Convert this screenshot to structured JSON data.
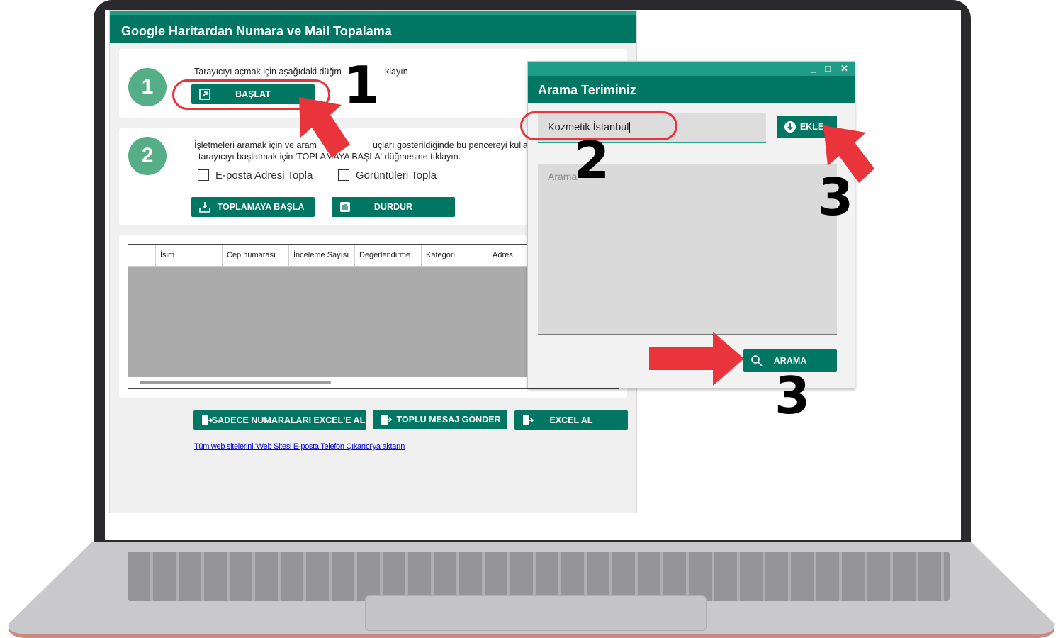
{
  "main_window": {
    "title": "Google Haritardan Numara ve Mail Topalama",
    "step1": {
      "number": "1",
      "instruction": "Tarayıcıyı açmak için aşağıdaki düğm",
      "instruction_end": "klayın",
      "start_button": "BAŞLAT"
    },
    "step2": {
      "number": "2",
      "instruction_line1": "İşletmeleri aramak için ve aram",
      "instruction_line1_end": "uçları gösterildiğinde bu pencereyi kullanın",
      "instruction_line2": "tarayıcıyı başlatmak için 'TOPLAMAYA BAŞLA' düğmesine tıklayın.",
      "checkbox_email": "E-posta Adresi Topla",
      "checkbox_images": "Görüntüleri Topla",
      "start_collect_button": "TOPLAMAYA BAŞLA",
      "stop_button": "DURDUR"
    },
    "table": {
      "columns": [
        "İsim",
        "Cep numarası",
        "İnceleme Sayısı",
        "Değerlendirme",
        "Kategori",
        "Adres"
      ]
    },
    "bottom_buttons": {
      "excel_numbers": "SADECE NUMARALARI EXCEL'E AL",
      "bulk_message": "TOPLU MESAJ GÖNDER",
      "excel": "EXCEL AL"
    },
    "link_text": "Tüm web sitelerini 'Web Sitesi E-posta Telefon Çıkarıcı'ya aktarın"
  },
  "dialog": {
    "title": "Arama Teriminiz",
    "controls": [
      "_",
      "□",
      "✕"
    ],
    "search_input_value": "Kozmetik İstanbul",
    "add_button": "EKLE",
    "textarea_placeholder": "Arama",
    "search_button": "ARAMA"
  },
  "annotations": {
    "label_1": "1",
    "label_2": "2",
    "label_3a": "3",
    "label_3b": "3"
  },
  "colors": {
    "brand_green": "#007663",
    "title_strip": "#1f9c85",
    "step_circle": "#55ae86",
    "annotation_red": "#e8343a"
  }
}
